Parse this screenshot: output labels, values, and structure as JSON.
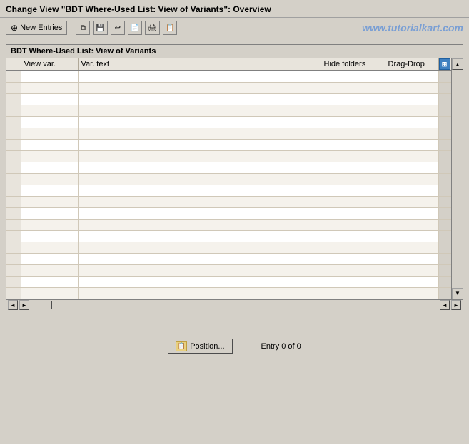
{
  "title_bar": {
    "text": "Change View \"BDT Where-Used List: View of Variants\": Overview"
  },
  "toolbar": {
    "new_entries_label": "New Entries",
    "watermark": "www.tutorialkart.com",
    "icons": [
      "copy-icon",
      "save-icon",
      "undo-icon",
      "another-save-icon",
      "print-icon",
      "export-icon"
    ]
  },
  "table": {
    "title": "BDT Where-Used List: View of Variants",
    "columns": [
      {
        "id": "selector",
        "label": ""
      },
      {
        "id": "view_var",
        "label": "View var."
      },
      {
        "id": "var_text",
        "label": "Var. text"
      },
      {
        "id": "hide_folders",
        "label": "Hide folders"
      },
      {
        "id": "drag_drop",
        "label": "Drag-Drop"
      }
    ],
    "rows": []
  },
  "footer": {
    "position_button_label": "Position...",
    "entry_info": "Entry 0 of 0"
  },
  "scrollbar": {
    "up_arrow": "▲",
    "down_arrow": "▼",
    "left_arrow": "◄",
    "right_arrow": "►"
  }
}
